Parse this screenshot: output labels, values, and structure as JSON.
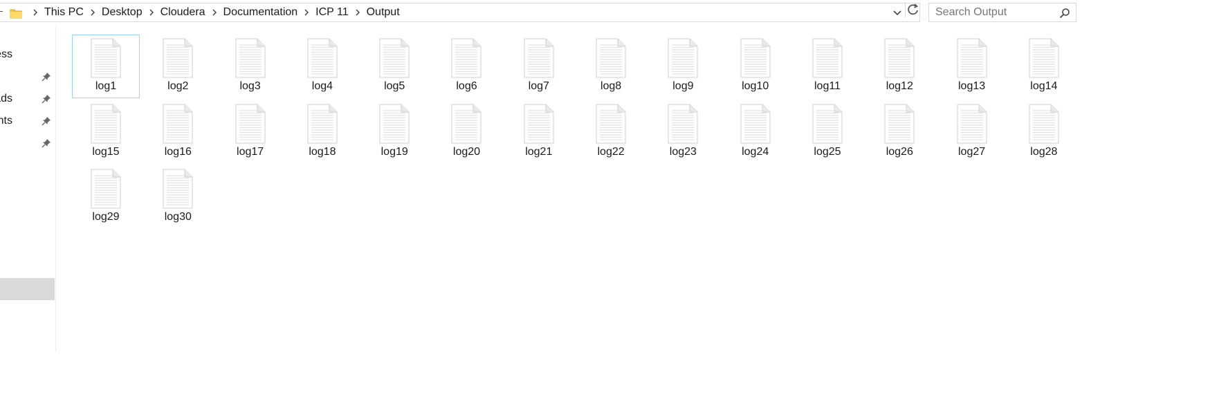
{
  "address_bar": {
    "breadcrumbs": [
      "This PC",
      "Desktop",
      "Cloudera",
      "Documentation",
      "ICP 11",
      "Output"
    ]
  },
  "search": {
    "placeholder": "Search Output",
    "value": ""
  },
  "nav_pane": {
    "items": [
      {
        "label": "ess",
        "pinned": false
      },
      {
        "label": "",
        "pinned": true
      },
      {
        "label": "ads",
        "pinned": true
      },
      {
        "label": "nts",
        "pinned": true
      },
      {
        "label": "",
        "pinned": true
      }
    ]
  },
  "files": [
    {
      "name": "log1",
      "selected": true
    },
    {
      "name": "log2"
    },
    {
      "name": "log3"
    },
    {
      "name": "log4"
    },
    {
      "name": "log5"
    },
    {
      "name": "log6"
    },
    {
      "name": "log7"
    },
    {
      "name": "log8"
    },
    {
      "name": "log9"
    },
    {
      "name": "log10"
    },
    {
      "name": "log11"
    },
    {
      "name": "log12"
    },
    {
      "name": "log13"
    },
    {
      "name": "log14"
    },
    {
      "name": "log15"
    },
    {
      "name": "log16"
    },
    {
      "name": "log17"
    },
    {
      "name": "log18"
    },
    {
      "name": "log19"
    },
    {
      "name": "log20"
    },
    {
      "name": "log21"
    },
    {
      "name": "log22"
    },
    {
      "name": "log23"
    },
    {
      "name": "log24"
    },
    {
      "name": "log25"
    },
    {
      "name": "log26"
    },
    {
      "name": "log27"
    },
    {
      "name": "log28"
    },
    {
      "name": "log29"
    },
    {
      "name": "log30"
    }
  ],
  "icons": {
    "folder": "folder-icon",
    "file": "text-document-icon",
    "pin": "pin-icon",
    "search": "search-icon",
    "refresh": "refresh-icon",
    "dropdown": "chevron-down-icon",
    "separator": "chevron-right-icon"
  },
  "colors": {
    "selection_border": "#99d1ff",
    "nav_selected": "#d9d9d9",
    "folder_yellow": "#f5c745"
  }
}
